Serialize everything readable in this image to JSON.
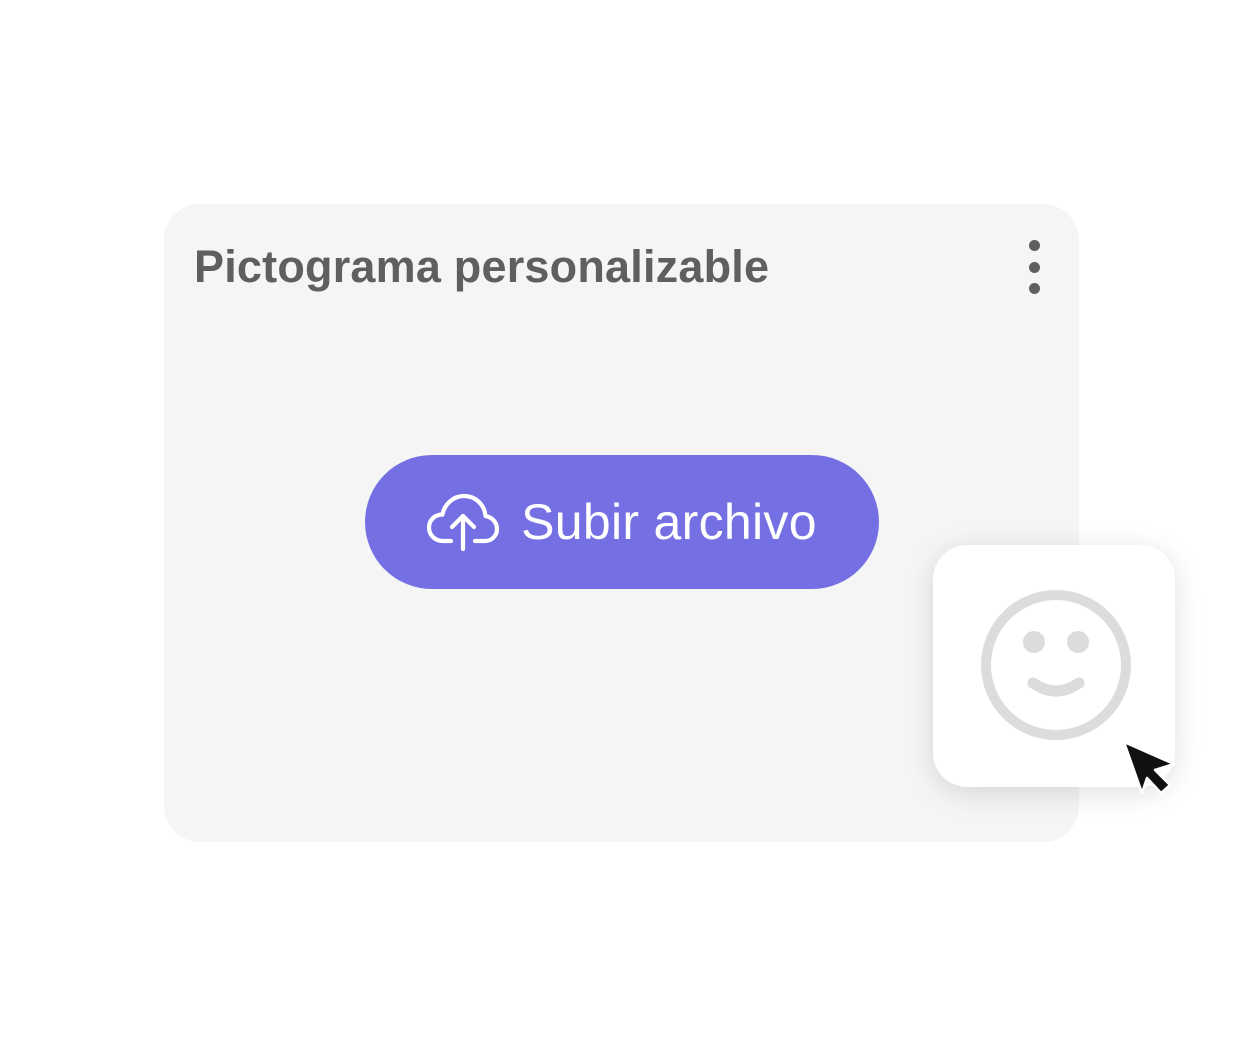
{
  "card": {
    "title": "Pictograma personalizable",
    "menu_icon": "kebab-menu-icon"
  },
  "upload": {
    "label": "Subir archivo",
    "icon": "cloud-upload-icon",
    "color": "#7470e4"
  },
  "pictogram": {
    "icon": "smiley-face-icon",
    "color": "#dcdcdc"
  },
  "pointer": {
    "icon": "mouse-pointer-icon"
  },
  "colors": {
    "card_background": "#f5f5f5",
    "title_text": "#5f5f5f",
    "button_text": "#ffffff"
  }
}
